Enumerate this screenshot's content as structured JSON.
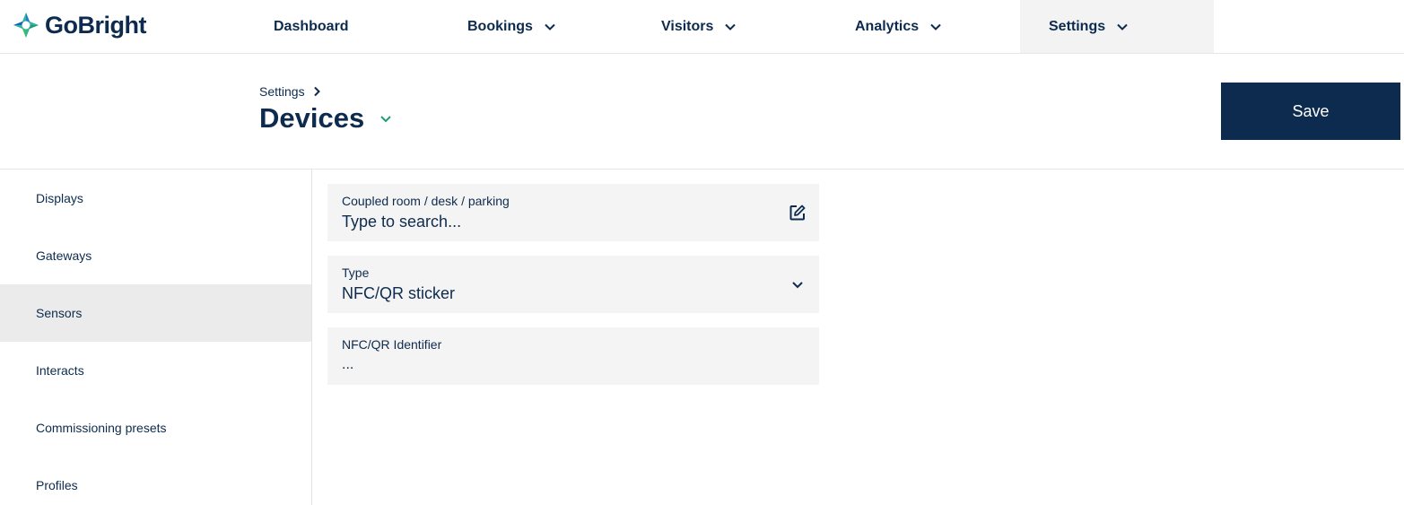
{
  "app": {
    "logo_text": "GoBright"
  },
  "nav": {
    "items": [
      {
        "label": "Dashboard",
        "has_dropdown": false
      },
      {
        "label": "Bookings",
        "has_dropdown": true
      },
      {
        "label": "Visitors",
        "has_dropdown": true
      },
      {
        "label": "Analytics",
        "has_dropdown": true
      },
      {
        "label": "Settings",
        "has_dropdown": true,
        "active": true
      }
    ]
  },
  "header": {
    "breadcrumb": "Settings",
    "title": "Devices",
    "save_label": "Save"
  },
  "sidebar": {
    "items": [
      {
        "label": "Displays"
      },
      {
        "label": "Gateways"
      },
      {
        "label": "Sensors",
        "active": true
      },
      {
        "label": "Interacts"
      },
      {
        "label": "Commissioning presets"
      },
      {
        "label": "Profiles"
      }
    ]
  },
  "form": {
    "coupled": {
      "label": "Coupled room / desk / parking",
      "placeholder": "Type to search..."
    },
    "type": {
      "label": "Type",
      "value": "NFC/QR sticker"
    },
    "identifier": {
      "label": "NFC/QR Identifier",
      "value": "..."
    }
  },
  "colors": {
    "brand_navy": "#0d2b4e",
    "accent_green": "#1f9d76",
    "active_bg": "#ebebeb"
  }
}
